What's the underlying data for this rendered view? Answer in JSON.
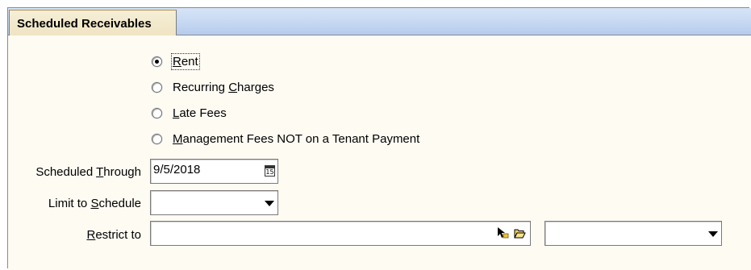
{
  "tab": {
    "label": "Scheduled Receivables"
  },
  "options": [
    {
      "pre": "",
      "key": "R",
      "post": "ent",
      "checked": true
    },
    {
      "pre": "Recurring ",
      "key": "C",
      "post": "harges",
      "checked": false
    },
    {
      "pre": "",
      "key": "L",
      "post": "ate Fees",
      "checked": false
    },
    {
      "pre": "",
      "key": "M",
      "post": "anagement Fees NOT on a Tenant Payment",
      "checked": false
    }
  ],
  "scheduled_through": {
    "pre": "Scheduled ",
    "key": "T",
    "post": "hrough",
    "value": "9/5/2018",
    "calendar_text": "15"
  },
  "limit_to_schedule": {
    "pre": "Limit to ",
    "key": "S",
    "post": "chedule",
    "value": ""
  },
  "restrict_to": {
    "pre": "",
    "key": "R",
    "post": "estrict to",
    "value": "",
    "second_value": ""
  },
  "icons": [
    "calendar-icon",
    "chevron-down-icon",
    "pointer-lookup-icon",
    "folder-open-icon"
  ],
  "colors": {
    "tab_bg": "#f6efd7",
    "strip_bg": "#c6d8f2",
    "content_bg": "#fefbf3"
  }
}
